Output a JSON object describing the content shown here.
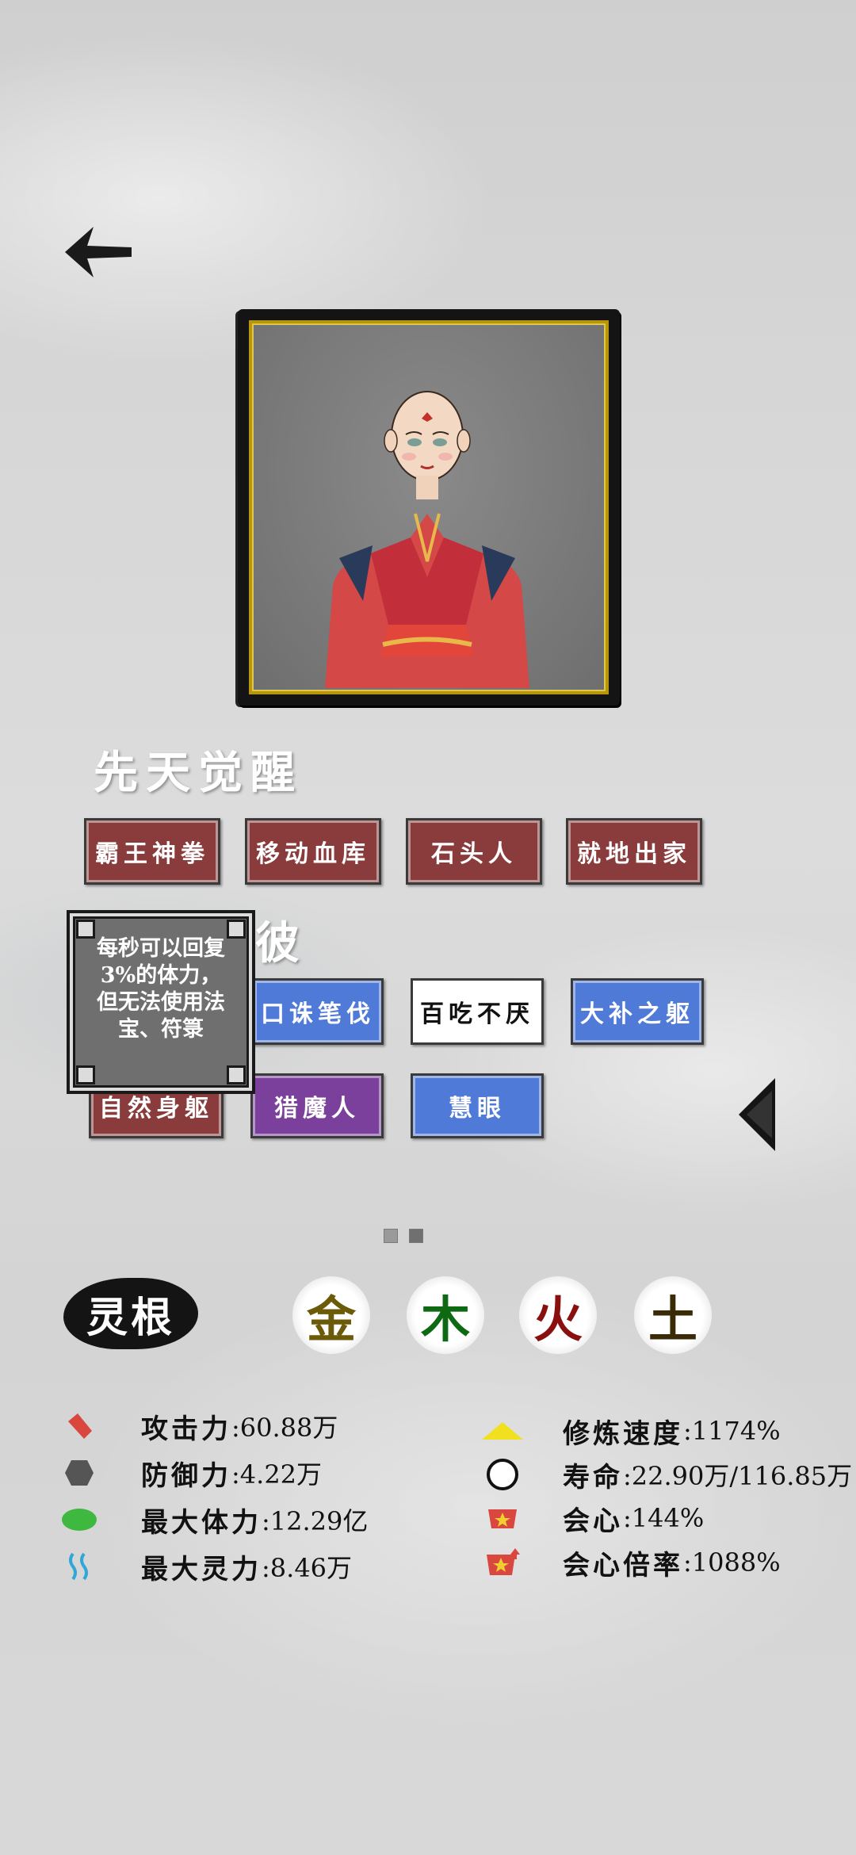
{
  "sections": {
    "innate_title": "先天觉醒",
    "acquired_title_visible": "彼"
  },
  "innate_skills": [
    {
      "label": "霸王神拳",
      "color": "red"
    },
    {
      "label": "移动血库",
      "color": "red"
    },
    {
      "label": "石头人",
      "color": "red"
    },
    {
      "label": "就地出家",
      "color": "red"
    }
  ],
  "acquired_skills_row1": [
    {
      "label": "口诛笔伐",
      "color": "blue"
    },
    {
      "label": "百吃不厌",
      "color": "white"
    },
    {
      "label": "大补之躯",
      "color": "blue"
    }
  ],
  "acquired_skills_row2": [
    {
      "label": "自然身躯",
      "color": "red"
    },
    {
      "label": "猎魔人",
      "color": "purple"
    },
    {
      "label": "慧眼",
      "color": "blue"
    }
  ],
  "tooltip": {
    "text": "每秒可以回复3%的体力，但无法使用法宝、符箓"
  },
  "pagination": {
    "total": 2,
    "current": 2
  },
  "spirit_root": {
    "label": "灵根",
    "elements": [
      {
        "char": "金",
        "color": "#6b5a08"
      },
      {
        "char": "木",
        "color": "#0e6a12"
      },
      {
        "char": "火",
        "color": "#8a1010"
      },
      {
        "char": "土",
        "color": "#3a2a05"
      }
    ]
  },
  "stats_left": [
    {
      "label": "攻击力",
      "value": ":60.88万",
      "icon": "attack-icon",
      "color": "#d9473f"
    },
    {
      "label": "防御力",
      "value": ":4.22万",
      "icon": "defense-icon",
      "color": "#555555"
    },
    {
      "label": "最大体力",
      "value": ":12.29亿",
      "icon": "health-icon",
      "color": "#3fb83f"
    },
    {
      "label": "最大灵力",
      "value": ":8.46万",
      "icon": "spirit-power-icon",
      "color": "#2fa8d8"
    }
  ],
  "stats_right": [
    {
      "label": "修炼速度",
      "value": ":1174%",
      "icon": "cultivation-icon",
      "color": "#f0e020"
    },
    {
      "label": "寿命",
      "value": ":22.90万/116.85万",
      "icon": "lifespan-icon",
      "color": "#ffffff"
    },
    {
      "label": "会心",
      "value": ":144%",
      "icon": "crit-icon",
      "color": "#d9473f"
    },
    {
      "label": "会心倍率",
      "value": ":1088%",
      "icon": "crit-rate-icon",
      "color": "#d9473f"
    }
  ]
}
